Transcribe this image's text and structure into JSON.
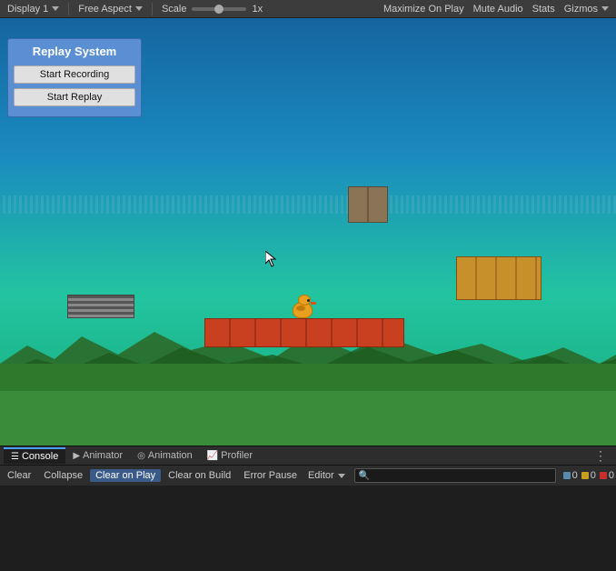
{
  "topbar": {
    "display": "Display 1",
    "aspect": "Free Aspect",
    "scale_label": "Scale",
    "scale_value": "1x",
    "on_play": "On Play",
    "maximize_on_play": "Maximize On Play",
    "mute_audio": "Mute Audio",
    "stats": "Stats",
    "gizmos": "Gizmos"
  },
  "replay_panel": {
    "title": "Replay System",
    "btn_start_recording": "Start Recording",
    "btn_start_replay": "Start Replay"
  },
  "tabs": {
    "console": "Console",
    "animator": "Animator",
    "animation": "Animation",
    "profiler": "Profiler"
  },
  "toolbar": {
    "clear": "Clear",
    "collapse": "Collapse",
    "clear_on_play": "Clear on Play",
    "clear_on_build": "Clear on Build",
    "error_pause": "Error Pause",
    "editor": "Editor",
    "search_placeholder": ""
  },
  "status_badges": {
    "messages": "0",
    "warnings": "0",
    "errors": "0"
  },
  "icons": {
    "console": "☰",
    "animator": "▶",
    "animation": "◎",
    "profiler": "📊",
    "search": "🔍",
    "menu": "⋮",
    "chevron": "▼",
    "message": "💬",
    "warning": "⚠",
    "error": "🔴"
  }
}
